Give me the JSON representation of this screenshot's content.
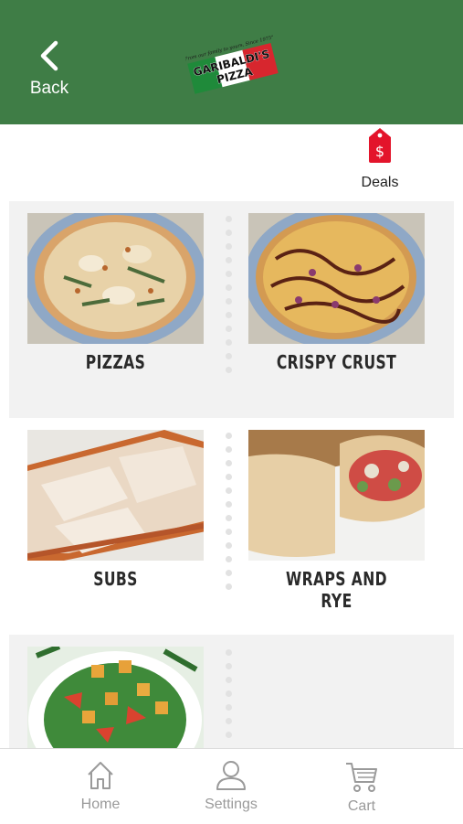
{
  "header": {
    "back_label": "Back",
    "logo_tagline": "\"From our family to yours, Since 1975\"",
    "logo_line1": "GARIBALDI'S",
    "logo_line2": "PIZZA",
    "bg_color": "#3f7d46"
  },
  "deals": {
    "label": "Deals",
    "icon": "price-tag-dollar-icon",
    "color": "#e3142b",
    "symbol": "$"
  },
  "categories": [
    {
      "label": "PIZZAS",
      "photo": "pizza-photo"
    },
    {
      "label": "CRISPY CRUST",
      "photo": "crispy-crust-pizza-photo"
    },
    {
      "label": "SUBS",
      "photo": "sub-sandwich-photo"
    },
    {
      "label": "WRAPS AND RYE",
      "photo": "wrap-photo"
    },
    {
      "label": "",
      "photo": "salad-photo"
    }
  ],
  "tabbar": {
    "items": [
      {
        "label": "Home",
        "icon": "home-icon"
      },
      {
        "label": "Settings",
        "icon": "user-icon"
      },
      {
        "label": "Cart",
        "icon": "cart-icon"
      }
    ]
  }
}
